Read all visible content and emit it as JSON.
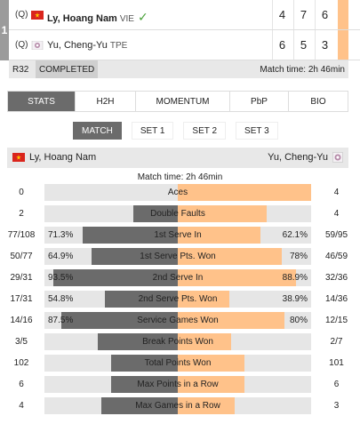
{
  "match": {
    "index": "1",
    "round": "R32",
    "status": "COMPLETED",
    "match_time_label": "Match time: 2h 46min",
    "players": [
      {
        "qualifier": "(Q)",
        "name": "Ly, Hoang Nam",
        "country": "VIE",
        "flag_icon": "vietnam-flag-icon",
        "winner": true,
        "sets": [
          "4",
          "7",
          "6"
        ]
      },
      {
        "qualifier": "(Q)",
        "name": "Yu, Cheng-Yu",
        "country": "TPE",
        "flag_icon": "chinese-taipei-flag-icon",
        "winner": false,
        "sets": [
          "6",
          "5",
          "3"
        ]
      }
    ]
  },
  "tabs": [
    "STATS",
    "H2H",
    "MOMENTUM",
    "PbP",
    "BIO"
  ],
  "active_tab": "STATS",
  "subtabs": [
    "MATCH",
    "SET 1",
    "SET 2",
    "SET 3"
  ],
  "active_subtab": "MATCH",
  "stats_header": {
    "left_player": "Ly, Hoang Nam",
    "right_player": "Yu, Cheng-Yu",
    "match_time": "Match time: 2h 46min"
  },
  "colors": {
    "left_bar": "#6b6b6b",
    "right_bar": "#ffc28a",
    "track": "#e6e6e6",
    "win_check": "#4aa23a"
  },
  "stats": [
    {
      "label": "Aces",
      "left": "0",
      "right": "4",
      "left_pct": "",
      "right_pct": "",
      "left_share": 0.0,
      "right_share": 1.0
    },
    {
      "label": "Double Faults",
      "left": "2",
      "right": "4",
      "left_pct": "",
      "right_pct": "",
      "left_share": 0.333,
      "right_share": 0.667
    },
    {
      "label": "1st Serve In",
      "left": "77/108",
      "right": "59/95",
      "left_pct": "71.3%",
      "right_pct": "62.1%",
      "left_share": 0.713,
      "right_share": 0.621
    },
    {
      "label": "1st Serve Pts. Won",
      "left": "50/77",
      "right": "46/59",
      "left_pct": "64.9%",
      "right_pct": "78%",
      "left_share": 0.649,
      "right_share": 0.78
    },
    {
      "label": "2nd Serve In",
      "left": "29/31",
      "right": "32/36",
      "left_pct": "93.5%",
      "right_pct": "88.9%",
      "left_share": 0.935,
      "right_share": 0.889
    },
    {
      "label": "2nd Serve Pts. Won",
      "left": "17/31",
      "right": "14/36",
      "left_pct": "54.8%",
      "right_pct": "38.9%",
      "left_share": 0.548,
      "right_share": 0.389
    },
    {
      "label": "Service Games Won",
      "left": "14/16",
      "right": "12/15",
      "left_pct": "87.5%",
      "right_pct": "80%",
      "left_share": 0.875,
      "right_share": 0.8
    },
    {
      "label": "Break Points Won",
      "left": "3/5",
      "right": "2/7",
      "left_pct": "",
      "right_pct": "",
      "left_share": 0.6,
      "right_share": 0.4
    },
    {
      "label": "Total Points Won",
      "left": "102",
      "right": "101",
      "left_pct": "",
      "right_pct": "",
      "left_share": 0.502,
      "right_share": 0.498
    },
    {
      "label": "Max Points in a Row",
      "left": "6",
      "right": "6",
      "left_pct": "",
      "right_pct": "",
      "left_share": 0.5,
      "right_share": 0.5
    },
    {
      "label": "Max Games in a Row",
      "left": "4",
      "right": "3",
      "left_pct": "",
      "right_pct": "",
      "left_share": 0.571,
      "right_share": 0.429
    }
  ]
}
